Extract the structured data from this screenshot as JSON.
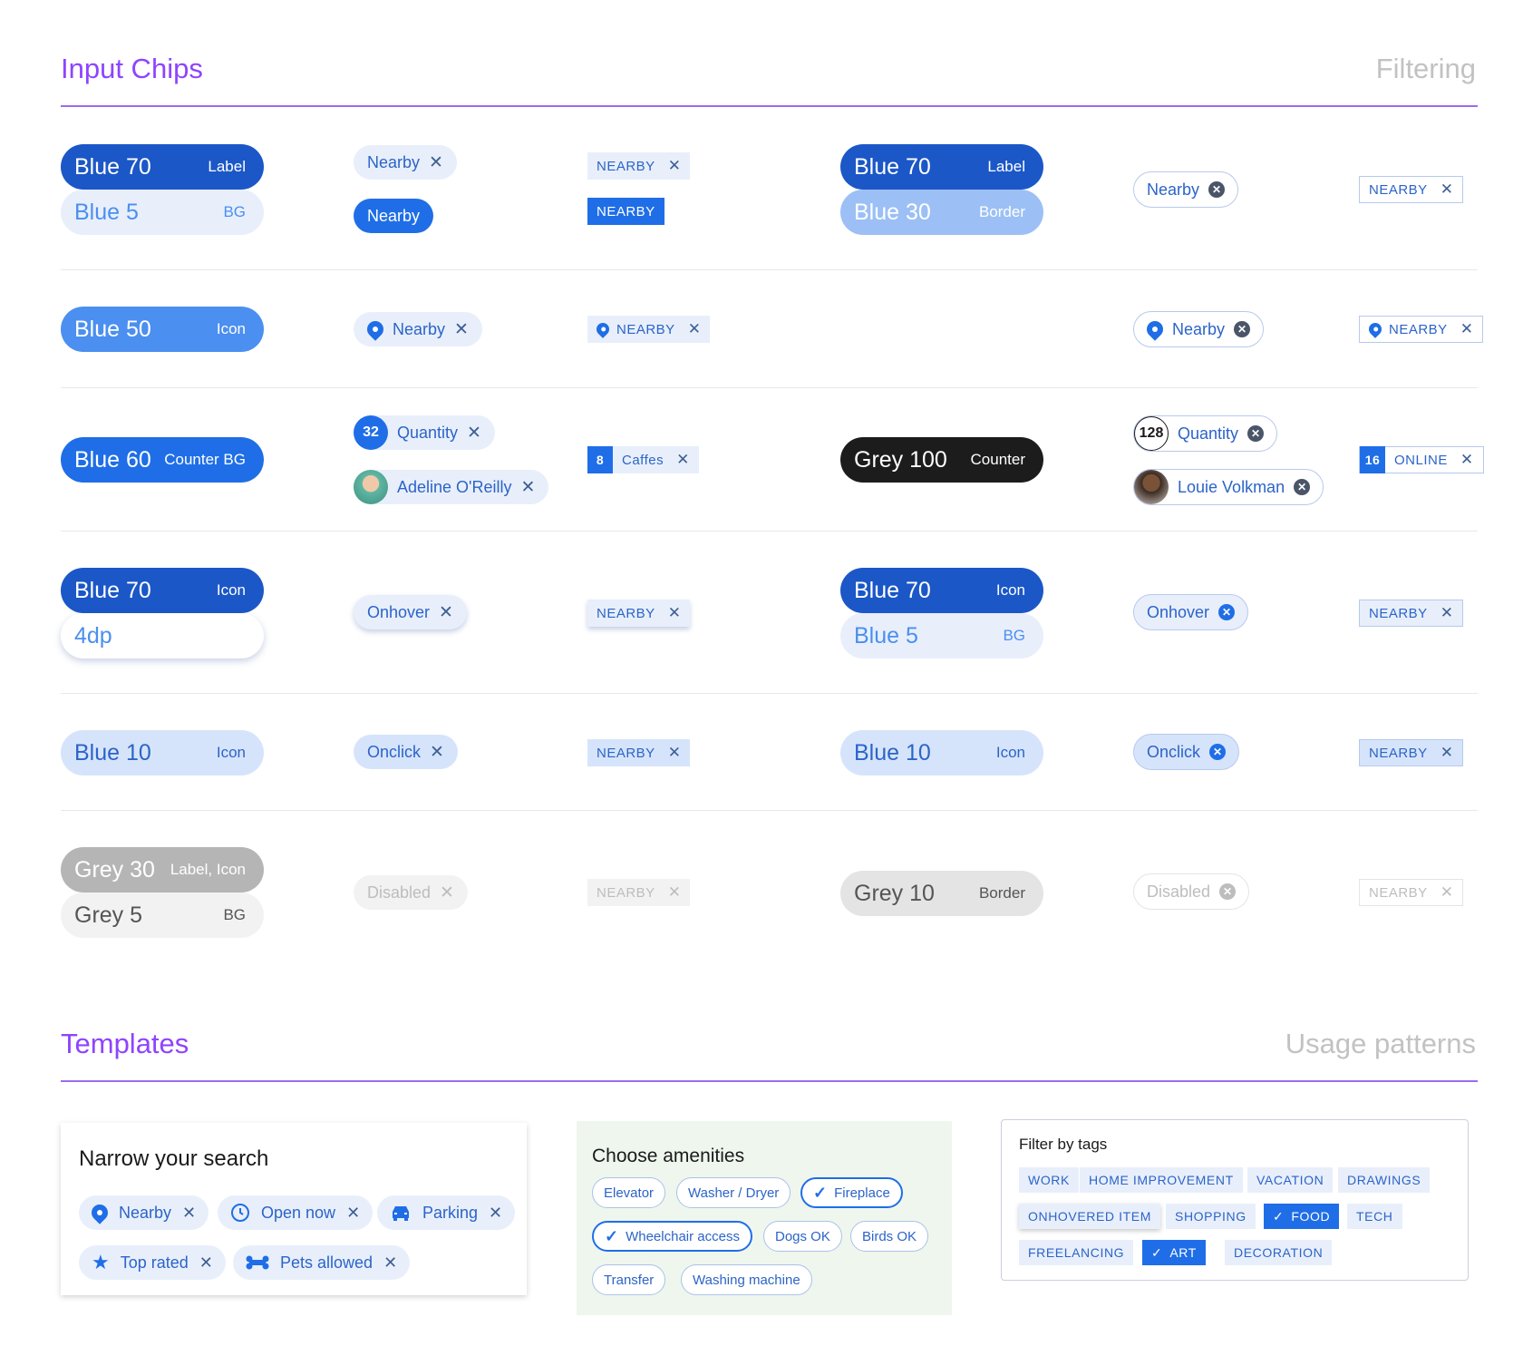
{
  "sections": {
    "input_chips": "Input Chips",
    "filtering": "Filtering",
    "templates": "Templates",
    "usage_patterns": "Usage patterns"
  },
  "colors": {
    "blue70": "#1b57c7",
    "blue60": "#1f6ee7",
    "blue50": "#4b8ff0",
    "blue30": "#9cc0f5",
    "blue10": "#d6e4fb",
    "blue5": "#e8effb",
    "grey100": "#1c1c1c",
    "grey30": "#b5b5b5",
    "grey10": "#e4e4e4",
    "grey5": "#f2f2f2",
    "accent_purple": "#8e44ff"
  },
  "rows": {
    "r1": {
      "sw_a_big": "Blue 70",
      "sw_a_small": "Label",
      "sw_b_big": "Blue 5",
      "sw_b_small": "BG",
      "chip": "Nearby",
      "chip_solid": "Nearby",
      "tag": "NEARBY",
      "tag_solid": "NEARBY",
      "sw_c_big": "Blue 70",
      "sw_c_small": "Label",
      "sw_d_big": "Blue 30",
      "sw_d_small": "Border",
      "ochip": "Nearby",
      "otag": "NEARBY"
    },
    "r2": {
      "sw_big": "Blue 50",
      "sw_small": "Icon",
      "chip": "Nearby",
      "tag": "NEARBY",
      "ochip": "Nearby",
      "otag": "NEARBY"
    },
    "r3": {
      "sw_big": "Blue 60",
      "sw_small": "Counter BG",
      "count": "32",
      "chip_count_label": "Quantity",
      "chip_avatar_label": "Adeline O'Reilly",
      "tag_count": "8",
      "tag_label": "Caffes",
      "sw_c_big": "Grey 100",
      "sw_c_small": "Counter",
      "ocount": "128",
      "ochip_count_label": "Quantity",
      "ochip_avatar_label": "Louie Volkman",
      "otag_count": "16",
      "otag_label": "ONLINE"
    },
    "r4": {
      "sw_a_big": "Blue 70",
      "sw_a_small": "Icon",
      "sw_b_big": "4dp",
      "chip": "Onhover",
      "tag": "NEARBY",
      "sw_c_big": "Blue 70",
      "sw_c_small": "Icon",
      "sw_d_big": "Blue 5",
      "sw_d_small": "BG",
      "ochip": "Onhover",
      "otag": "NEARBY"
    },
    "r5": {
      "sw_big": "Blue 10",
      "sw_small": "Icon",
      "chip": "Onclick",
      "tag": "NEARBY",
      "sw_c_big": "Blue 10",
      "sw_c_small": "Icon",
      "ochip": "Onclick",
      "otag": "NEARBY"
    },
    "r6": {
      "sw_a_big": "Grey 30",
      "sw_a_small": "Label, Icon",
      "sw_b_big": "Grey 5",
      "sw_b_small": "BG",
      "chip": "Disabled",
      "tag": "NEARBY",
      "sw_c_big": "Grey 10",
      "sw_c_small": "Border",
      "ochip": "Disabled",
      "otag": "NEARBY"
    }
  },
  "close_glyph": "✕",
  "templates": {
    "search": {
      "title": "Narrow your search",
      "chips": [
        "Nearby",
        "Open now",
        "Parking",
        "Top rated",
        "Pets allowed"
      ]
    },
    "amenities": {
      "title": "Choose amenities",
      "items": [
        "Elevator",
        "Washer / Dryer",
        "Fireplace",
        "Wheelchair access",
        "Dogs OK",
        "Birds OK",
        "Transfer",
        "Washing machine"
      ],
      "selected": [
        "Fireplace",
        "Wheelchair access"
      ]
    },
    "tags": {
      "title": "Filter by tags",
      "items": [
        "WORK",
        "HOME IMPROVEMENT",
        "VACATION",
        "DRAWINGS",
        "ONHOVERED ITEM",
        "SHOPPING",
        "FOOD",
        "TECH",
        "FREELANCING",
        "ART",
        "DECORATION"
      ],
      "selected": [
        "FOOD",
        "ART"
      ],
      "hovered": "ONHOVERED ITEM"
    }
  }
}
